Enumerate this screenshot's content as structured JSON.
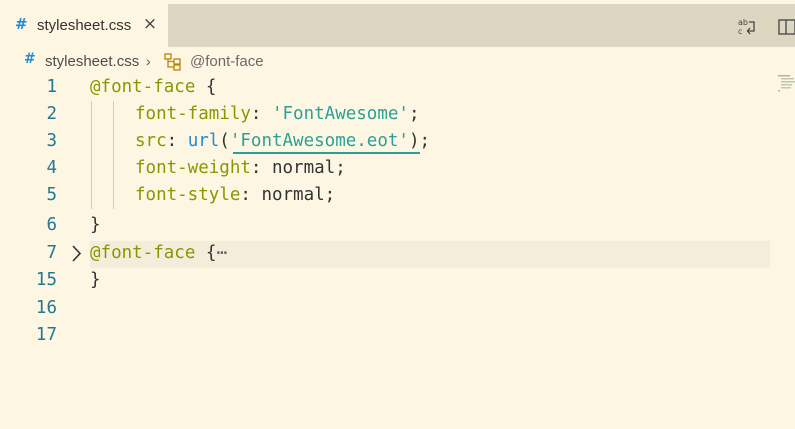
{
  "tab": {
    "hash": "#",
    "filename": "stylesheet.css",
    "close": "×"
  },
  "actions": {
    "compare_icon": "compare-changes-icon",
    "split_icon": "split-editor-icon"
  },
  "breadcrumb": {
    "hash": "#",
    "file": "stylesheet.css",
    "chevron": "›",
    "symbol_icon": "symbol-class-icon",
    "symbol": "@font-face"
  },
  "editor": {
    "lines": [
      {
        "n": "1"
      },
      {
        "n": "2"
      },
      {
        "n": "3"
      },
      {
        "n": "4"
      },
      {
        "n": "5"
      },
      {
        "n": "6"
      },
      {
        "n": "7"
      },
      {
        "n": "15"
      },
      {
        "n": "16"
      },
      {
        "n": "17"
      }
    ],
    "tokens": {
      "l1_kw": "@font-face",
      "l1_rest": " {",
      "l2_prop": "font-family",
      "l2_colon": ": ",
      "l2_val": "'FontAwesome'",
      "l2_end": ";",
      "l3_prop": "src",
      "l3_colon": ": ",
      "l3_fn": "url",
      "l3_open": "(",
      "l3_val": "'FontAwesome.eot'",
      "l3_close": ");",
      "l4_prop": "font-weight",
      "l4_colon": ": ",
      "l4_val": "normal;",
      "l5_prop": "font-style",
      "l5_colon": ": ",
      "l5_val": "normal;",
      "l6": "}",
      "l7_kw": "@font-face",
      "l7_rest": " {",
      "l7_ell": "⋯",
      "l15": "}"
    }
  },
  "colors": {
    "background": "#fdf6e3",
    "tabbar": "#ddd6c1",
    "keyword": "#859900",
    "string": "#2aa198",
    "function": "#268bd2",
    "line_number": "#237893"
  }
}
